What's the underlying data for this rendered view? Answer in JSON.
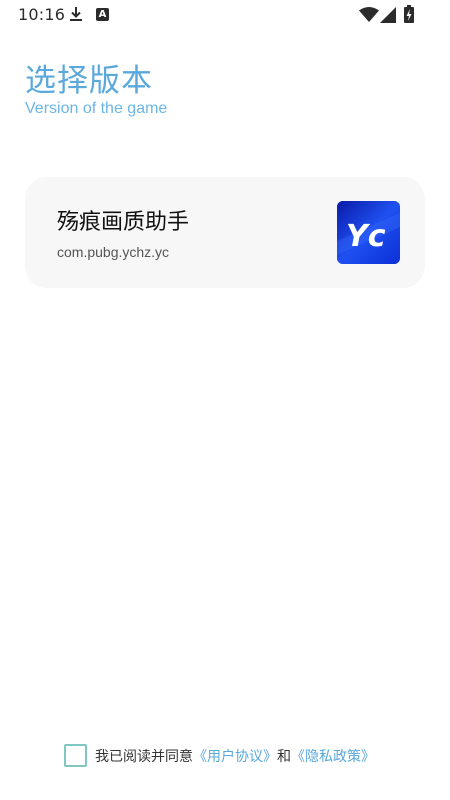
{
  "status_bar": {
    "time": "10:16",
    "download_icon": "download-icon",
    "a_icon_letter": "A",
    "wifi_icon": "wifi-icon",
    "signal_icon": "signal-icon",
    "battery_icon": "battery-charging-icon"
  },
  "header": {
    "title": "选择版本",
    "subtitle": "Version of the game"
  },
  "versions": [
    {
      "name": "殇痕画质助手",
      "package": "com.pubg.ychz.yc",
      "icon": "app-logo-yc",
      "icon_text": "Yc"
    }
  ],
  "agreement": {
    "prefix": "我已阅读并同意",
    "user_agreement": "《用户协议》",
    "conjunction": "和",
    "privacy_policy": "《隐私政策》",
    "checked": false
  },
  "colors": {
    "accent": "#5aa8dc",
    "checkbox_border": "#7fc7c2",
    "card_bg": "#f7f7f7",
    "icon_blue": "#1a48e6"
  }
}
